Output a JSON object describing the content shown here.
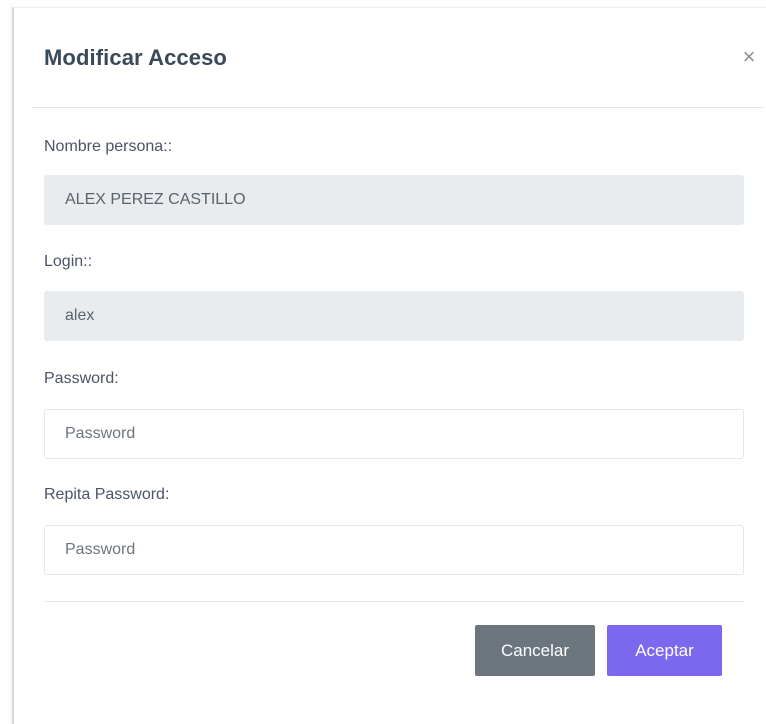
{
  "modal": {
    "title": "Modificar Acceso",
    "close_icon": "×"
  },
  "fields": {
    "nombre": {
      "label": "Nombre persona::",
      "value": "ALEX PEREZ CASTILLO"
    },
    "login": {
      "label": "Login::",
      "value": "alex"
    },
    "password": {
      "label": "Password:",
      "placeholder": "Password",
      "value": ""
    },
    "repeat_password": {
      "label": "Repita Password:",
      "placeholder": "Password",
      "value": ""
    }
  },
  "footer": {
    "cancel_label": "Cancelar",
    "accept_label": "Aceptar"
  },
  "colors": {
    "accent": "#7b68ee",
    "secondary": "#6c757d",
    "readonly_bg": "#e9ecef"
  }
}
